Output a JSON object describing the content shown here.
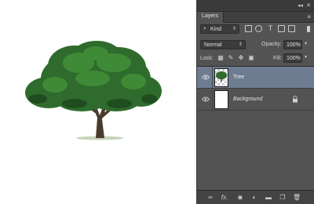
{
  "canvas": {
    "background": "#ffffff",
    "image_icon": "tree-image"
  },
  "panel": {
    "tab_label": "Layers",
    "collapse_glyph": "◂◂",
    "close_glyph": "✕",
    "menu_glyph": "≡",
    "filter": {
      "kind_label": "Kind",
      "filter_icons": [
        "image-filter-icon",
        "adjustment-filter-icon",
        "type-filter-icon",
        "shape-filter-icon",
        "smart-object-filter-icon"
      ]
    },
    "blend": {
      "mode": "Normal",
      "opacity_label": "Opacity:",
      "opacity_value": "100%"
    },
    "lock": {
      "label": "Lock:",
      "fill_label": "Fill:",
      "fill_value": "100%"
    },
    "layers": [
      {
        "name": "Tree",
        "selected": true,
        "visible": true,
        "thumbnail": "tree-thumbnail"
      },
      {
        "name": "Background",
        "selected": false,
        "visible": true,
        "locked": true,
        "thumbnail": "white-thumbnail"
      }
    ],
    "bottom_icons": [
      "link-icon",
      "fx-icon",
      "mask-icon",
      "adjustment-icon",
      "folder-icon",
      "new-layer-icon",
      "trash-icon"
    ],
    "bottom_glyphs": {
      "link": "∞",
      "fx": "fx."
    }
  }
}
